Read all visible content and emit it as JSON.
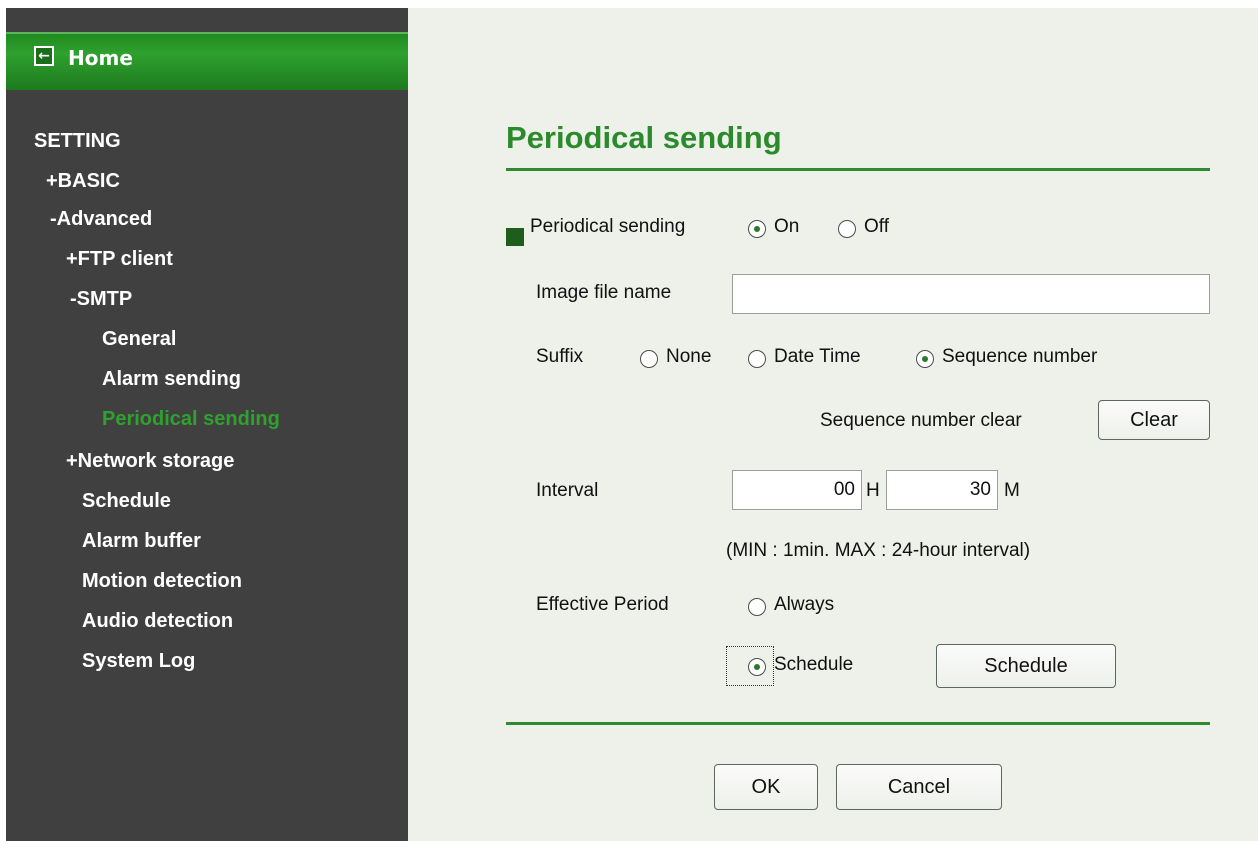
{
  "sidebar": {
    "home_label": "Home",
    "items": [
      {
        "label": "SETTING"
      },
      {
        "label": "+BASIC"
      },
      {
        "label": "-Advanced"
      },
      {
        "label": "+FTP client"
      },
      {
        "label": "-SMTP"
      },
      {
        "label": "General"
      },
      {
        "label": "Alarm sending"
      },
      {
        "label": "Periodical sending",
        "active": true
      },
      {
        "label": "+Network storage"
      },
      {
        "label": "Schedule"
      },
      {
        "label": "Alarm buffer"
      },
      {
        "label": "Motion detection"
      },
      {
        "label": "Audio detection"
      },
      {
        "label": "System Log"
      }
    ]
  },
  "page": {
    "title": "Periodical sending",
    "periodical": {
      "label": "Periodical sending",
      "on": "On",
      "off": "Off",
      "selected": "On"
    },
    "image_file_name": {
      "label": "Image file name",
      "value": ""
    },
    "suffix": {
      "label": "Suffix",
      "none": "None",
      "date_time": "Date Time",
      "sequence": "Sequence number",
      "selected": "Sequence number"
    },
    "sequence_clear": {
      "label": "Sequence number clear",
      "button": "Clear"
    },
    "interval": {
      "label": "Interval",
      "hours": "00",
      "hours_unit": "H",
      "minutes": "30",
      "minutes_unit": "M",
      "note": "(MIN : 1min. MAX : 24-hour interval)"
    },
    "effective_period": {
      "label": "Effective Period",
      "always": "Always",
      "schedule": "Schedule",
      "schedule_button": "Schedule",
      "selected": "Schedule"
    },
    "ok_button": "OK",
    "cancel_button": "Cancel"
  },
  "colors": {
    "accent_green": "#2b8a2b",
    "sidebar_bg": "#404040",
    "content_bg": "#eef0ea"
  }
}
